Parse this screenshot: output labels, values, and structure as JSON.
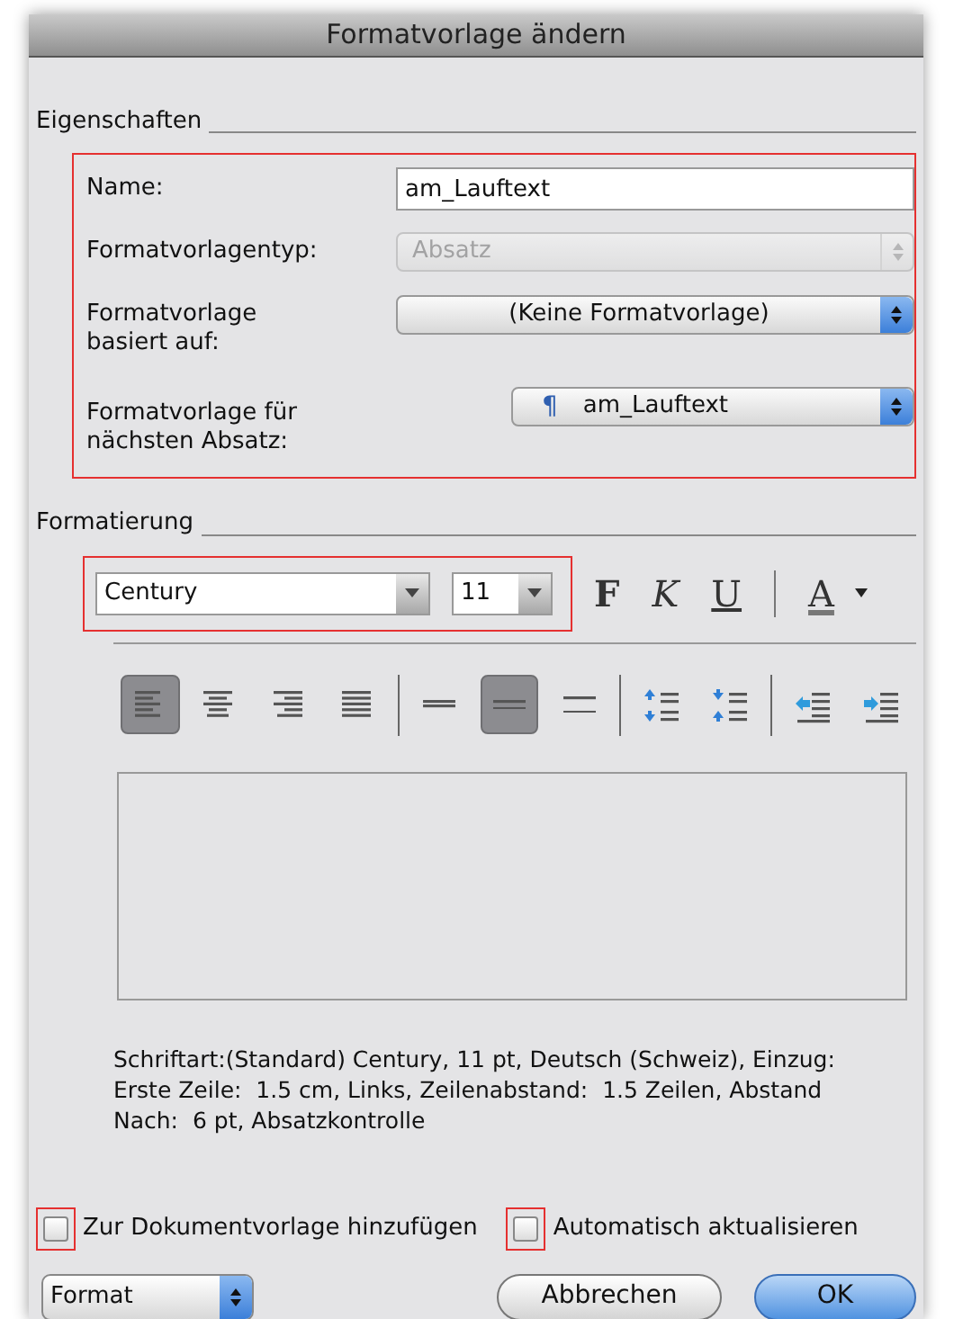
{
  "window": {
    "title": "Formatvorlage ändern"
  },
  "properties": {
    "heading": "Eigenschaften",
    "name": {
      "label": "Name:",
      "value": "am_Lauftext"
    },
    "style_type": {
      "label": "Formatvorlagentyp:",
      "value": "Absatz",
      "disabled": true
    },
    "based_on": {
      "label_lines": [
        "Formatvorlage",
        "basiert auf:"
      ],
      "value": "(Keine Formatvorlage)"
    },
    "next_style": {
      "label_lines": [
        "Formatvorlage für",
        "nächsten Absatz:"
      ],
      "mark": "¶",
      "value": "am_Lauftext"
    }
  },
  "formatting": {
    "heading": "Formatierung",
    "font": "Century",
    "size": "11",
    "text_buttons": [
      {
        "label": "F",
        "kind": "bold"
      },
      {
        "label": "K",
        "kind": "italic"
      },
      {
        "label": "U",
        "kind": "underline"
      },
      {
        "label": "A",
        "kind": "color"
      }
    ],
    "tool_groups": [
      [
        {
          "kind": "align-left",
          "selected": true
        },
        {
          "kind": "align-center",
          "selected": false
        },
        {
          "kind": "align-right",
          "selected": false
        },
        {
          "kind": "justify",
          "selected": false
        }
      ],
      [
        {
          "kind": "single",
          "selected": false
        },
        {
          "kind": "one-half",
          "selected": true
        },
        {
          "kind": "double",
          "selected": false
        }
      ],
      [
        {
          "kind": "space-up",
          "selected": false
        },
        {
          "kind": "space-down",
          "selected": false
        }
      ],
      [
        {
          "kind": "outdent",
          "selected": false
        },
        {
          "kind": "indent",
          "selected": false
        }
      ]
    ],
    "description_lines": [
      "Schriftart:(Standard) Century, 11 pt, Deutsch (Schweiz), Einzug:",
      "Erste Zeile:  1.5 cm, Links, Zeilenabstand:  1.5 Zeilen, Abstand",
      "Nach:  6 pt, Absatzkontrolle"
    ]
  },
  "options": [
    {
      "label": "Zur Dokumentvorlage hinzufügen",
      "checked": false
    },
    {
      "label": "Automatisch aktualisieren",
      "checked": false
    }
  ],
  "footer": {
    "menu": "Format",
    "buttons": [
      {
        "label": "Abbrechen",
        "kind": "cancel"
      },
      {
        "label": "OK",
        "kind": "default"
      }
    ]
  }
}
